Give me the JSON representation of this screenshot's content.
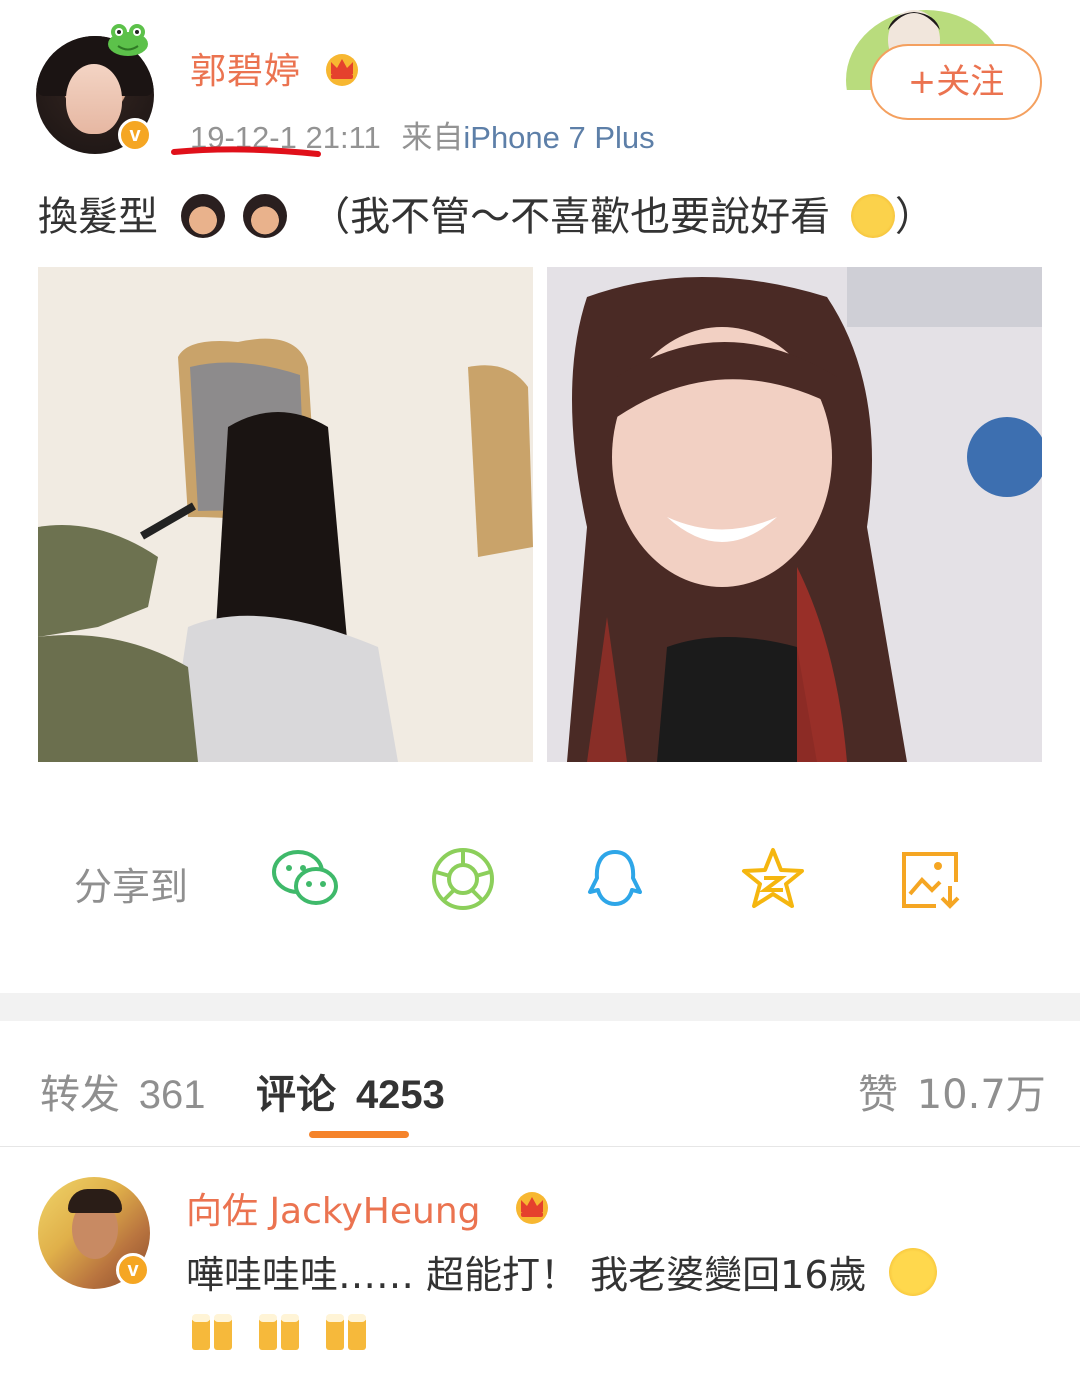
{
  "post": {
    "username": "郭碧婷",
    "time": "19-12-1 21:11",
    "source_prefix": "来自",
    "source_device": "iPhone 7 Plus",
    "follow_label": "+关注",
    "text_lead": "換髮型",
    "text_body": "（我不管～不喜歡也要說好看",
    "text_tail": "）"
  },
  "share": {
    "label": "分享到",
    "icons": [
      "wechat-icon",
      "moments-icon",
      "qq-icon",
      "qzone-icon",
      "save-image-icon"
    ]
  },
  "stats": {
    "repost_label": "转发",
    "repost_count": "361",
    "comment_label": "评论",
    "comment_count": "4253",
    "like_label": "赞",
    "like_count": "10.7万"
  },
  "comment": {
    "username": "向佐 JackyHeung",
    "text": "嘩哇哇哇…… 超能打！ 我老婆變回16歲"
  },
  "colors": {
    "accent": "#eb7350",
    "link": "#5d7fa8",
    "tab_indicator": "#f5832a",
    "vip_badge": "#f5a623"
  }
}
